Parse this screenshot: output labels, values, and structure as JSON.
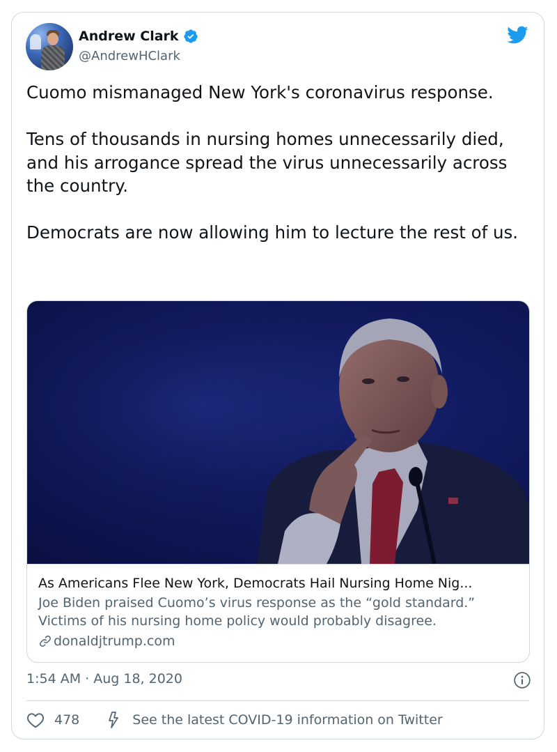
{
  "author": {
    "name": "Andrew Clark",
    "handle": "@AndrewHClark",
    "verified": true
  },
  "tweet": {
    "paragraphs": [
      "Cuomo mismanaged New York's coronavirus response.",
      "Tens of thousands in nursing homes unnecessarily died, and his arrogance spread the virus unnecessarily across the country.",
      "Democrats are now allowing him to lecture the rest of us."
    ],
    "timestamp": "1:54 AM · Aug 18, 2020"
  },
  "link_card": {
    "title": "As Americans Flee New York, Democrats Hail Nursing Home Nig...",
    "description": "Joe Biden praised Cuomo’s virus response as the “gold standard.” Victims of his nursing home policy would probably disagree.",
    "domain": "donaldjtrump.com"
  },
  "actions": {
    "likes": "478",
    "covid_label": "See the latest COVID-19 information on Twitter"
  },
  "colors": {
    "brand_blue": "#1d9bf0",
    "text_primary": "#0f1419",
    "text_secondary": "#536471",
    "border": "#cfd9de"
  },
  "icons": [
    "verified-badge-icon",
    "twitter-bird-icon",
    "link-icon",
    "info-icon",
    "heart-icon",
    "lightning-bolt-icon"
  ]
}
